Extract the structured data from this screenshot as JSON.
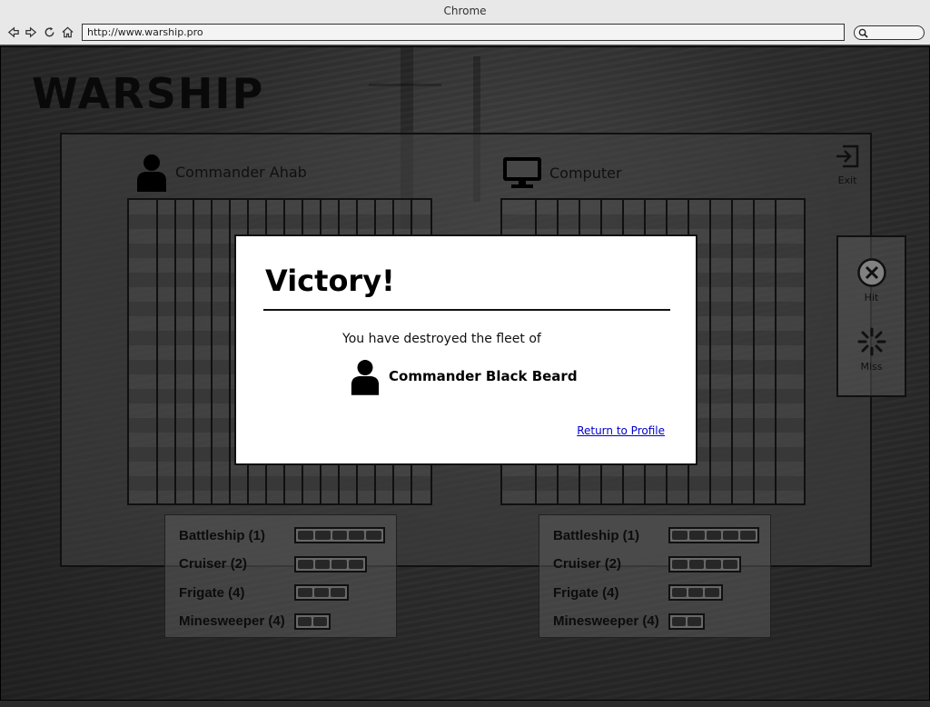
{
  "browser": {
    "title": "Chrome",
    "url": "http://www.warship.pro"
  },
  "app": {
    "title": "WARSHIP",
    "exit_label": "Exit"
  },
  "players": {
    "left": {
      "name": "Commander Ahab",
      "icon": "user-icon"
    },
    "right": {
      "name": "Computer",
      "icon": "monitor-icon"
    }
  },
  "legend": {
    "hit_label": "Hit",
    "miss_label": "Miss"
  },
  "fleets": {
    "left": [
      {
        "label": "Battleship (1)",
        "segments": 5
      },
      {
        "label": "Cruiser (2)",
        "segments": 4
      },
      {
        "label": "Frigate (4)",
        "segments": 3
      },
      {
        "label": "Minesweeper (4)",
        "segments": 2
      }
    ],
    "right": [
      {
        "label": "Battleship (1)",
        "segments": 5
      },
      {
        "label": "Cruiser (2)",
        "segments": 4
      },
      {
        "label": "Frigate (4)",
        "segments": 3
      },
      {
        "label": "Minesweeper (4)",
        "segments": 2
      }
    ]
  },
  "modal": {
    "title": "Victory!",
    "message": "You have destroyed the fleet of",
    "opponent": "Commander Black Beard",
    "link": "Return to Profile"
  }
}
